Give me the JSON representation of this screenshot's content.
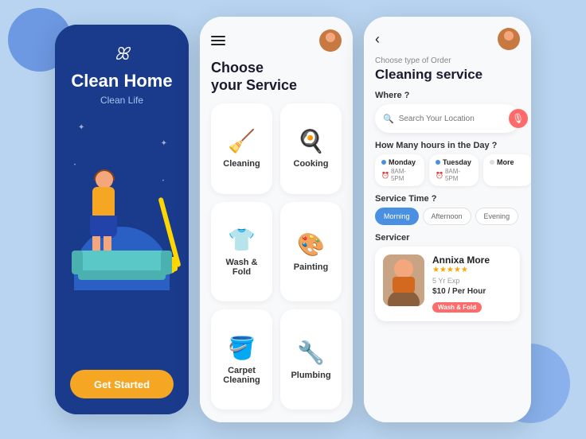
{
  "background": "#b8d4f0",
  "screen1": {
    "logo": "ꕤ",
    "title": "Clean Home",
    "subtitle": "Clean Life",
    "btn_label": "Get Started"
  },
  "screen2": {
    "heading_line1": "Choose",
    "heading_line2": "your Service",
    "services": [
      {
        "id": "cleaning",
        "label": "Cleaning",
        "icon": "🧹"
      },
      {
        "id": "cooking",
        "label": "Cooking",
        "icon": "🍳"
      },
      {
        "id": "wash-fold",
        "label": "Wash & Fold",
        "icon": "👕"
      },
      {
        "id": "painting",
        "label": "Painting",
        "icon": "🖌️"
      },
      {
        "id": "carpet-cleaning",
        "label": "Carpet Cleaning",
        "icon": "🪣"
      },
      {
        "id": "plumbing",
        "label": "Plumbing",
        "icon": "🔧"
      }
    ]
  },
  "screen3": {
    "order_type": "Choose type of Order",
    "title": "Cleaning service",
    "where_label": "Where ?",
    "location_placeholder": "Search Your Location",
    "hours_label": "How Many hours in the Day ?",
    "time_label": "Service Time ?",
    "servicer_label": "Servicer",
    "days": [
      {
        "name": "Monday",
        "time": "8AM-5PM",
        "dot": "blue"
      },
      {
        "name": "Tuesday",
        "time": "8AM-5PM",
        "dot": "blue"
      },
      {
        "name": "More",
        "time": "",
        "dot": "gray"
      }
    ],
    "time_options": [
      {
        "label": "Morning",
        "active": true
      },
      {
        "label": "Afternoon",
        "active": false
      },
      {
        "label": "Evening",
        "active": false
      }
    ],
    "servicer": {
      "name": "Annixa More",
      "exp": "5 Yr Exp",
      "stars": "★★★★★",
      "rate": "$10 / Per Hour",
      "tag": "Wash & Fold"
    }
  }
}
